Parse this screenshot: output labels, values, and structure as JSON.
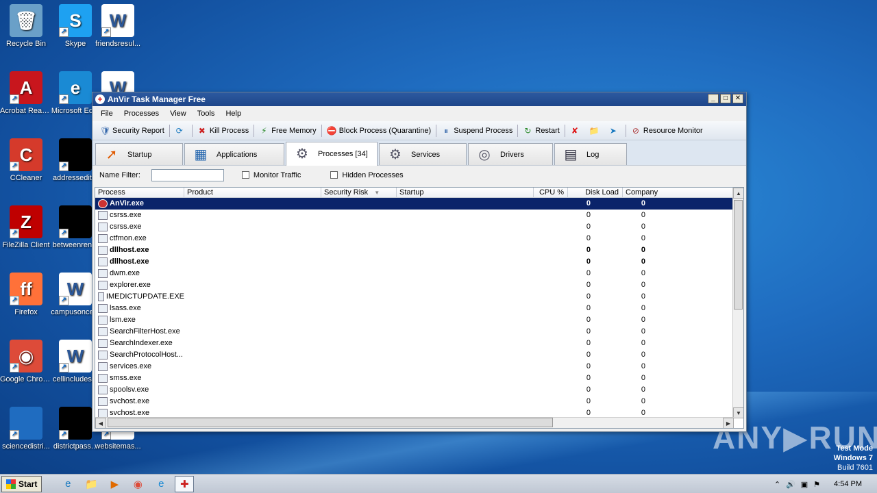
{
  "desktop": {
    "icons": [
      {
        "label": "Recycle Bin",
        "glyph": "🗑",
        "color": "#6aa0c8"
      },
      {
        "label": "Skype",
        "glyph": "S",
        "color": "#1ea1f1"
      },
      {
        "label": "friendsresul...",
        "glyph": "W",
        "color": "#ffffff"
      },
      {
        "label": "Acrobat Reader DC",
        "glyph": "A",
        "color": "#c8161d"
      },
      {
        "label": "Microsoft Ed...",
        "glyph": "e",
        "color": "#1a8ad4"
      },
      {
        "label": "",
        "glyph": "W",
        "color": "#ffffff"
      },
      {
        "label": "CCleaner",
        "glyph": "C",
        "color": "#d53a2b"
      },
      {
        "label": "addressedit...",
        "glyph": "",
        "color": "#000000"
      },
      {
        "label": "FileZilla Client",
        "glyph": "Z",
        "color": "#bf0000"
      },
      {
        "label": "betweenren...",
        "glyph": "",
        "color": "#000000"
      },
      {
        "label": "Firefox",
        "glyph": "ff",
        "color": "#ff7139"
      },
      {
        "label": "campusonce...",
        "glyph": "W",
        "color": "#ffffff"
      },
      {
        "label": "Google Chrome",
        "glyph": "◉",
        "color": "#dd4b39"
      },
      {
        "label": "cellincludes...",
        "glyph": "W",
        "color": "#ffffff"
      },
      {
        "label": "sciencedistri...",
        "glyph": "",
        "color": "#1f6cc0"
      },
      {
        "label": "districtpass...",
        "glyph": "",
        "color": "#000000"
      },
      {
        "label": "websitemas...",
        "glyph": "",
        "color": "#ffffff"
      }
    ],
    "watermark": "ANY▶RUN",
    "test_mode": [
      "Test Mode",
      "Windows 7",
      "Build 7601"
    ]
  },
  "window": {
    "title": "AnVir Task Manager Free",
    "menu": [
      "File",
      "Processes",
      "View",
      "Tools",
      "Help"
    ],
    "toolbar": [
      {
        "label": "Security Report",
        "icon": "shield-icon",
        "glyph": "🛡"
      },
      {
        "label": "",
        "icon": "refresh-icon",
        "glyph": "⟳"
      },
      {
        "label": "Kill Process",
        "icon": "kill-icon",
        "glyph": "✖"
      },
      {
        "label": "Free Memory",
        "icon": "memory-icon",
        "glyph": "⚡"
      },
      {
        "label": "Block Process (Quarantine)",
        "icon": "block-icon",
        "glyph": "⛔"
      },
      {
        "label": "Suspend Process",
        "icon": "suspend-icon",
        "glyph": "⏸"
      },
      {
        "label": "Restart",
        "icon": "restart-icon",
        "glyph": "↻"
      },
      {
        "label": "",
        "icon": "delete-icon",
        "glyph": "✘"
      },
      {
        "label": "",
        "icon": "folder-icon",
        "glyph": "📁"
      },
      {
        "label": "",
        "icon": "arrow-icon",
        "glyph": "➤"
      },
      {
        "label": "Resource Monitor",
        "icon": "monitor-icon",
        "glyph": "⊘"
      }
    ],
    "tabs": [
      {
        "label": "Startup",
        "glyph": "➚",
        "active": false
      },
      {
        "label": "Applications",
        "glyph": "▦",
        "active": false
      },
      {
        "label": "Processes [34]",
        "glyph": "⚙",
        "active": true
      },
      {
        "label": "Services",
        "glyph": "⚙",
        "active": false
      },
      {
        "label": "Drivers",
        "glyph": "◎",
        "active": false
      },
      {
        "label": "Log",
        "glyph": "▤",
        "active": false
      }
    ],
    "filter": {
      "name_label": "Name Filter:",
      "name_value": "",
      "monitor_traffic": "Monitor Traffic",
      "hidden_processes": "Hidden Processes"
    },
    "columns": [
      "Process",
      "Product",
      "Security Risk",
      "Startup",
      "CPU %",
      "Disk Load",
      "Company"
    ],
    "rows": [
      {
        "name": "AnVir.exe",
        "cpu": "0",
        "disk": "0",
        "bold": true,
        "selected": true
      },
      {
        "name": "csrss.exe",
        "cpu": "0",
        "disk": "0",
        "bold": false,
        "selected": false
      },
      {
        "name": "csrss.exe",
        "cpu": "0",
        "disk": "0",
        "bold": false,
        "selected": false
      },
      {
        "name": "ctfmon.exe",
        "cpu": "0",
        "disk": "0",
        "bold": false,
        "selected": false
      },
      {
        "name": "dllhost.exe",
        "cpu": "0",
        "disk": "0",
        "bold": true,
        "selected": false
      },
      {
        "name": "dllhost.exe",
        "cpu": "0",
        "disk": "0",
        "bold": true,
        "selected": false
      },
      {
        "name": "dwm.exe",
        "cpu": "0",
        "disk": "0",
        "bold": false,
        "selected": false
      },
      {
        "name": "explorer.exe",
        "cpu": "0",
        "disk": "0",
        "bold": false,
        "selected": false
      },
      {
        "name": "IMEDICTUPDATE.EXE",
        "cpu": "0",
        "disk": "0",
        "bold": false,
        "selected": false
      },
      {
        "name": "lsass.exe",
        "cpu": "0",
        "disk": "0",
        "bold": false,
        "selected": false
      },
      {
        "name": "lsm.exe",
        "cpu": "0",
        "disk": "0",
        "bold": false,
        "selected": false
      },
      {
        "name": "SearchFilterHost.exe",
        "cpu": "0",
        "disk": "0",
        "bold": false,
        "selected": false
      },
      {
        "name": "SearchIndexer.exe",
        "cpu": "0",
        "disk": "0",
        "bold": false,
        "selected": false
      },
      {
        "name": "SearchProtocolHost...",
        "cpu": "0",
        "disk": "0",
        "bold": false,
        "selected": false
      },
      {
        "name": "services.exe",
        "cpu": "0",
        "disk": "0",
        "bold": false,
        "selected": false
      },
      {
        "name": "smss.exe",
        "cpu": "0",
        "disk": "0",
        "bold": false,
        "selected": false
      },
      {
        "name": "spoolsv.exe",
        "cpu": "0",
        "disk": "0",
        "bold": false,
        "selected": false
      },
      {
        "name": "svchost.exe",
        "cpu": "0",
        "disk": "0",
        "bold": false,
        "selected": false
      },
      {
        "name": "svchost.exe",
        "cpu": "0",
        "disk": "0",
        "bold": false,
        "selected": false
      }
    ]
  },
  "taskbar": {
    "start_label": "Start",
    "apps": [
      {
        "name": "ie",
        "glyph": "e",
        "active": false
      },
      {
        "name": "explorer",
        "glyph": "📁",
        "active": false
      },
      {
        "name": "media",
        "glyph": "▶",
        "active": false
      },
      {
        "name": "chrome",
        "glyph": "◉",
        "active": false
      },
      {
        "name": "edge",
        "glyph": "e",
        "active": false
      },
      {
        "name": "anvir",
        "glyph": "✚",
        "active": true
      }
    ],
    "clock": "4:54 PM"
  }
}
